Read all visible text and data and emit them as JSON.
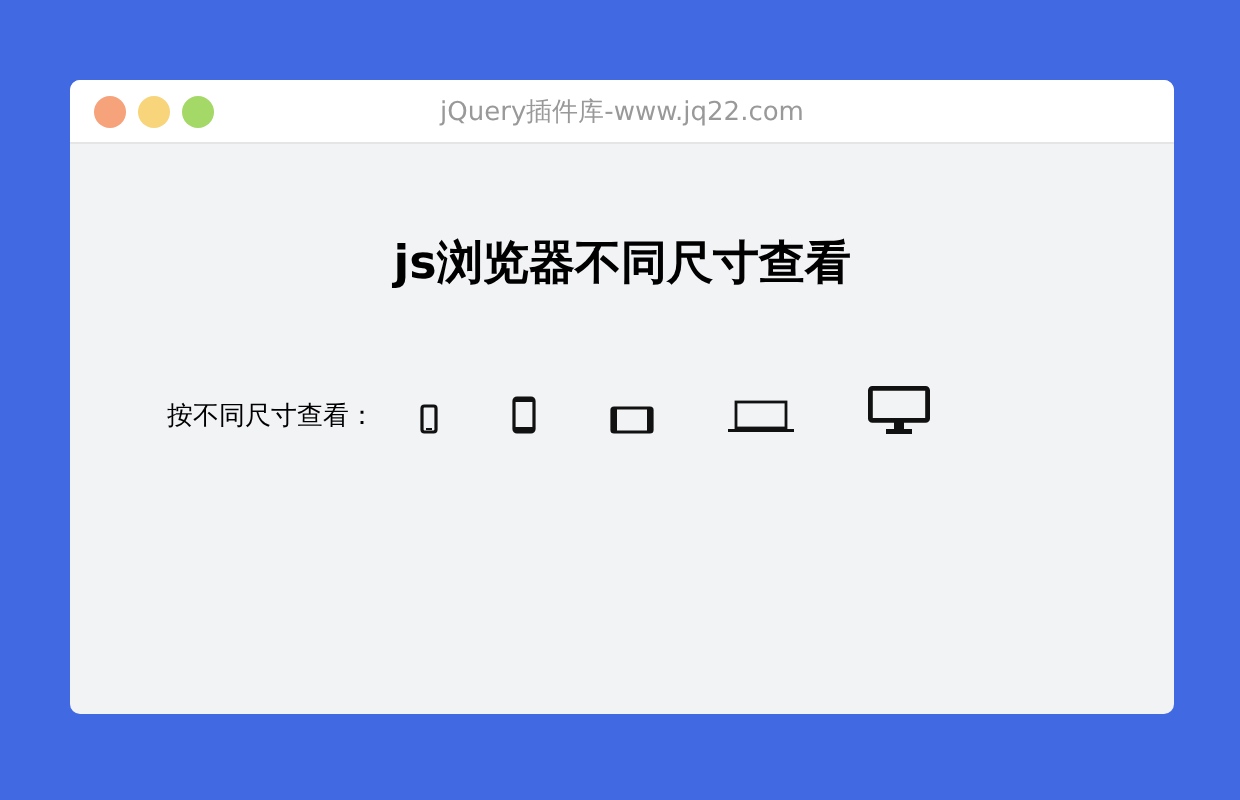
{
  "window": {
    "title": "jQuery插件库-www.jq22.com"
  },
  "heading": "js浏览器不同尺寸查看",
  "size_label": "按不同尺寸查看：",
  "devices": [
    {
      "kind": "phone-small"
    },
    {
      "kind": "phone"
    },
    {
      "kind": "tablet"
    },
    {
      "kind": "laptop"
    },
    {
      "kind": "desktop"
    }
  ]
}
